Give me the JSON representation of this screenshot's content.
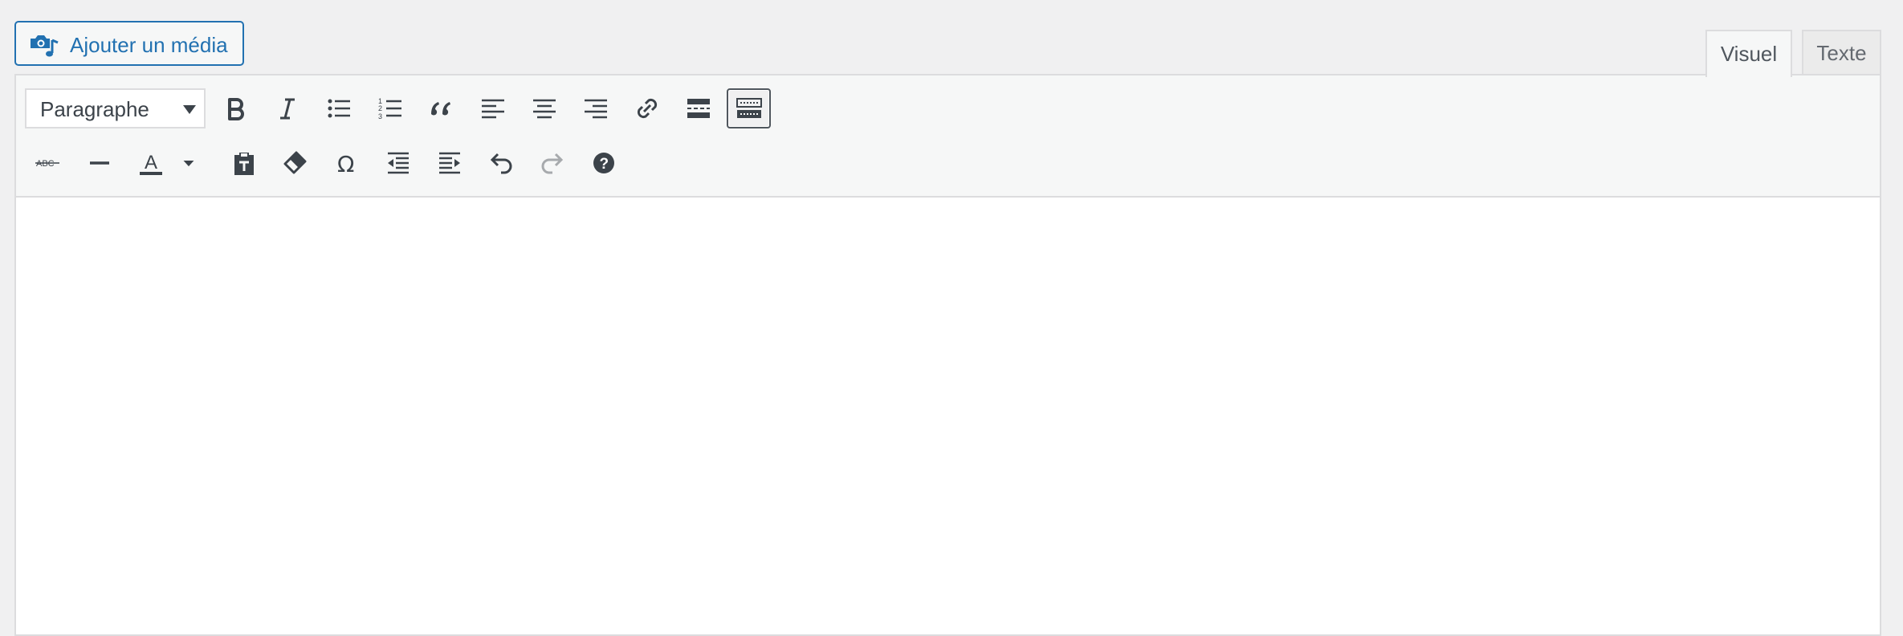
{
  "media_button": {
    "label": "Ajouter un média",
    "icon": "media-camera-music-icon"
  },
  "tabs": [
    {
      "label": "Visuel",
      "active": true
    },
    {
      "label": "Texte",
      "active": false
    }
  ],
  "toolbar": {
    "format_select": {
      "value": "Paragraphe"
    },
    "row1": [
      {
        "name": "bold-icon"
      },
      {
        "name": "italic-icon"
      },
      {
        "name": "bullet-list-icon"
      },
      {
        "name": "numbered-list-icon",
        "numbers": [
          "1",
          "2",
          "3"
        ]
      },
      {
        "name": "blockquote-icon"
      },
      {
        "name": "align-left-icon"
      },
      {
        "name": "align-center-icon"
      },
      {
        "name": "align-right-icon"
      },
      {
        "name": "link-icon"
      },
      {
        "name": "read-more-icon"
      },
      {
        "name": "toolbar-toggle-icon",
        "active": true
      }
    ],
    "row2": [
      {
        "name": "strikethrough-icon",
        "text": "ABC"
      },
      {
        "name": "horizontal-line-icon"
      },
      {
        "name": "text-color-icon",
        "text": "A"
      },
      {
        "name": "text-color-dropdown-icon"
      },
      {
        "name": "paste-as-text-icon"
      },
      {
        "name": "clear-formatting-icon"
      },
      {
        "name": "special-character-icon",
        "text": "Ω"
      },
      {
        "name": "outdent-icon"
      },
      {
        "name": "indent-icon"
      },
      {
        "name": "undo-icon"
      },
      {
        "name": "redo-icon",
        "disabled": true
      },
      {
        "name": "help-icon",
        "text": "?"
      }
    ]
  },
  "colors": {
    "accent": "#2271b1",
    "icon": "#3c434a",
    "border": "#dcdcde",
    "toolbar_bg": "#f6f7f7",
    "page_bg": "#f0f0f1",
    "disabled_icon": "#a7aaad"
  }
}
